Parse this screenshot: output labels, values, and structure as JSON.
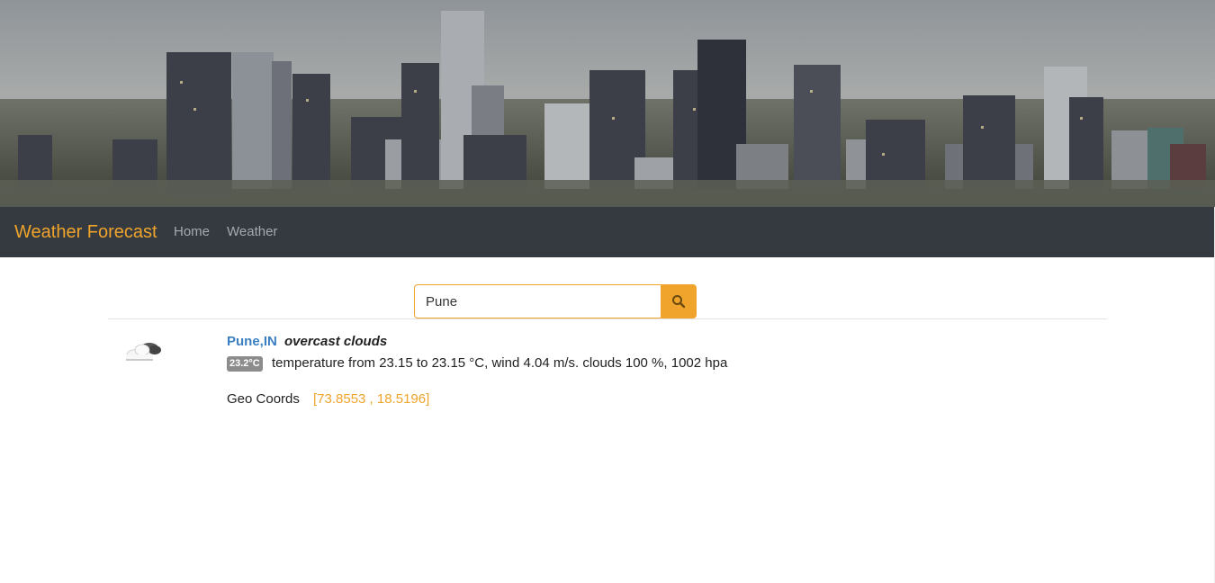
{
  "navbar": {
    "brand": "Weather Forecast",
    "links": [
      {
        "label": "Home"
      },
      {
        "label": "Weather"
      }
    ]
  },
  "search": {
    "value": "Pune",
    "button_icon": "search-icon"
  },
  "result": {
    "icon": "overcast-clouds-icon",
    "city": "Pune,IN",
    "description": "overcast clouds",
    "temp_badge": "23.2°C",
    "details": "temperature from 23.15 to 23.15 °C, wind 4.04 m/s. clouds 100 %, 1002 hpa",
    "geo_label": "Geo Coords",
    "geo_value": "[73.8553 , 18.5196]"
  },
  "colors": {
    "accent": "#f0a42b",
    "navbar_bg": "#343a40",
    "link_blue": "#3a7fc1",
    "badge_bg": "#8c8c8c"
  }
}
